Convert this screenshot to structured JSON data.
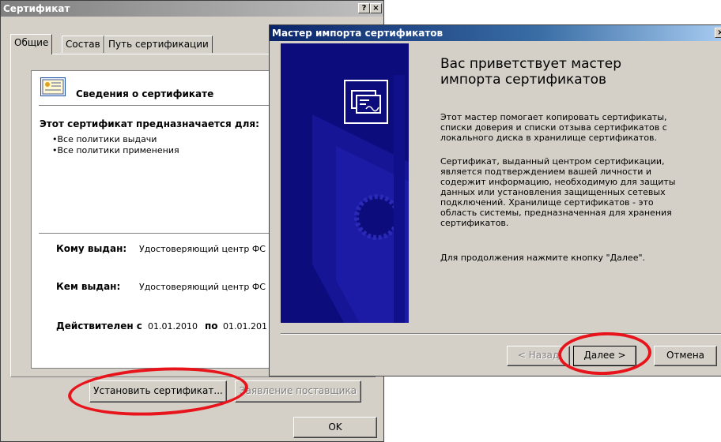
{
  "cert_dialog": {
    "title": "Сертификат",
    "help_btn": "?",
    "close_btn": "×",
    "tabs": [
      {
        "label": "Общие"
      },
      {
        "label": "Состав"
      },
      {
        "label": "Путь сертификации"
      }
    ],
    "info_heading": "Сведения о сертификате",
    "purpose_heading": "Этот сертификат предназначается для:",
    "purposes": [
      "•Все политики выдачи",
      "•Все политики применения"
    ],
    "issued_to_label": "Кому выдан:",
    "issued_to_value": "Удостоверяющий центр ФС",
    "issued_by_label": "Кем выдан:",
    "issued_by_value": "Удостоверяющий центр ФС",
    "valid_from_label": "Действителен с",
    "valid_from": "01.01.2010",
    "valid_to_label": "по",
    "valid_to": "01.01.201",
    "install_button": "Установить сертификат...",
    "statement_button": "Заявление поставщика",
    "ok_button": "OK"
  },
  "wizard": {
    "title": "Мастер импорта сертификатов",
    "close_btn": "×",
    "heading_line1": "Вас приветствует мастер",
    "heading_line2": "импорта сертификатов",
    "para1": [
      "Этот мастер помогает копировать сертификаты,",
      "списки доверия и списки отзыва сертификатов с",
      "локального диска в хранилище сертификатов."
    ],
    "para2": [
      "Сертификат, выданный центром сертификации,",
      "является подтверждением вашей личности и",
      "содержит информацию, необходимую для защиты",
      "данных или установления защищенных сетевых",
      "подключений. Хранилище сертификатов - это",
      "область системы, предназначенная для хранения",
      "сертификатов."
    ],
    "para3": "Для продолжения нажмите кнопку \"Далее\".",
    "back_button": "< Назад",
    "next_button": "Далее >",
    "cancel_button": "Отмена"
  },
  "colors": {
    "title_active": "#0a246a",
    "title_inactive": "#808080",
    "wizard_banner": "#0c0c7c",
    "annotation": "#e8141c"
  },
  "icons": [
    "certificate-icon",
    "certificate-wizard-icon"
  ]
}
